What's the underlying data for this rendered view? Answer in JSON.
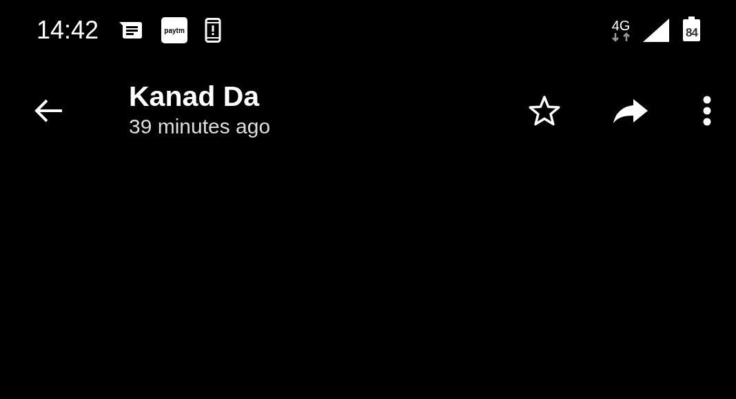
{
  "status_bar": {
    "time": "14:42",
    "notification_logo": "paytm",
    "network": "4G",
    "battery": "84"
  },
  "app_bar": {
    "title": "Kanad Da",
    "subtitle": "39 minutes ago"
  }
}
